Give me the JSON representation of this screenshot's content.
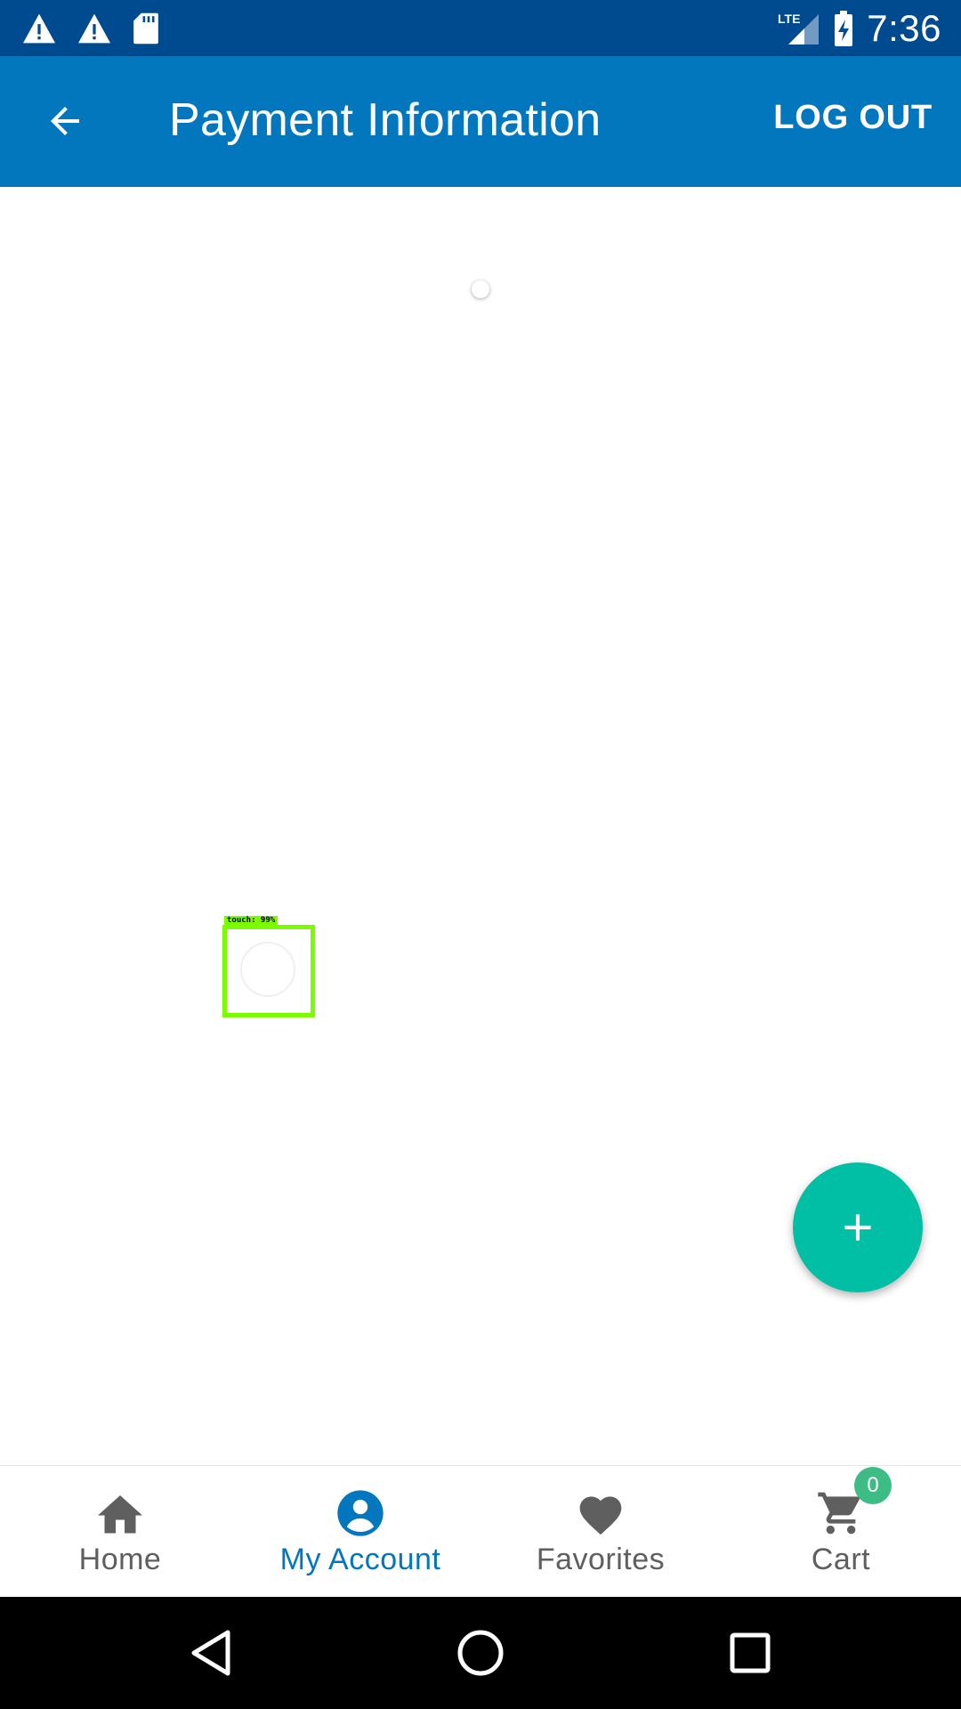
{
  "status_bar": {
    "time": "7:36",
    "network": "LTE",
    "icons": [
      "warning-icon",
      "warning-icon",
      "sd-card-icon",
      "lte-signal-icon",
      "battery-charging-icon"
    ]
  },
  "app_bar": {
    "title": "Payment Information",
    "logout_label": "LOG OUT",
    "back_icon": "arrow-back-icon"
  },
  "overlay": {
    "touch_label": "touch: 99%"
  },
  "fab": {
    "icon": "plus-icon"
  },
  "bottom_nav": {
    "items": [
      {
        "label": "Home",
        "icon": "home-icon",
        "active": false
      },
      {
        "label": "My Account",
        "icon": "account-icon",
        "active": true
      },
      {
        "label": "Favorites",
        "icon": "heart-icon",
        "active": false
      },
      {
        "label": "Cart",
        "icon": "cart-icon",
        "active": false
      }
    ],
    "cart_badge": "0"
  },
  "system_nav": {
    "buttons": [
      "back-triangle-icon",
      "home-circle-icon",
      "recents-square-icon"
    ]
  },
  "colors": {
    "status_bar": "#004a8f",
    "app_bar": "#0277bd",
    "fab": "#00bfa5",
    "badge": "#3ebc86",
    "active_nav": "#0277bd",
    "inactive_nav": "#5f5f5f"
  }
}
